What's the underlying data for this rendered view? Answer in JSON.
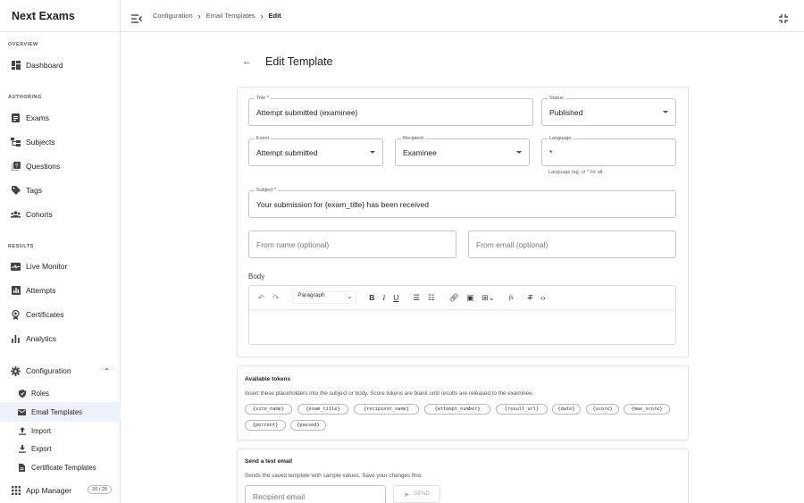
{
  "app": {
    "title": "Next Exams"
  },
  "sidebar": {
    "sections": {
      "overview": "OVERVIEW",
      "authoring": "AUTHORING",
      "results": "RESULTS"
    },
    "items": [
      {
        "label": "Dashboard",
        "icon": "dashboard-icon"
      },
      {
        "label": "Exams",
        "icon": "exams-icon"
      },
      {
        "label": "Subjects",
        "icon": "subjects-icon"
      },
      {
        "label": "Questions",
        "icon": "questions-icon"
      },
      {
        "label": "Tags",
        "icon": "tag-icon"
      },
      {
        "label": "Cohorts",
        "icon": "cohorts-icon"
      },
      {
        "label": "Live Monitor",
        "icon": "monitor-icon"
      },
      {
        "label": "Attempts",
        "icon": "attempts-icon"
      },
      {
        "label": "Certificates",
        "icon": "certificate-icon"
      },
      {
        "label": "Analytics",
        "icon": "analytics-icon"
      },
      {
        "label": "Configuration",
        "icon": "gear-icon"
      }
    ],
    "config_sub": [
      {
        "label": "Roles",
        "icon": "shield-icon"
      },
      {
        "label": "Email Templates",
        "icon": "mail-icon"
      },
      {
        "label": "Import",
        "icon": "upload-icon"
      },
      {
        "label": "Export",
        "icon": "download-icon"
      },
      {
        "label": "Certificate Templates",
        "icon": "document-icon"
      }
    ],
    "app_manager": {
      "label": "App Manager",
      "badge": "20 / 20"
    }
  },
  "breadcrumb": {
    "items": [
      "Configuration",
      "Email Templates",
      "Edit"
    ]
  },
  "page": {
    "title": "Edit Template"
  },
  "form": {
    "title": {
      "label": "Title *",
      "value": "Attempt submitted (examinee)"
    },
    "status": {
      "label": "Status",
      "value": "Published"
    },
    "event": {
      "label": "Event",
      "value": "Attempt submitted"
    },
    "recipient": {
      "label": "Recipient",
      "value": "Examinee"
    },
    "language": {
      "label": "Language",
      "value": "*",
      "helper": "Language tag, or * for all"
    },
    "subject": {
      "label": "Subject *",
      "value": "Your submission for {exam_title} has been received"
    },
    "from_name": {
      "placeholder": "From name (optional)"
    },
    "from_email": {
      "placeholder": "From email (optional)"
    },
    "body_label": "Body",
    "paragraph": "Paragraph"
  },
  "tokens": {
    "title": "Available tokens",
    "description": "Insert these placeholders into the subject or body. Score tokens are blank until results are released to the examinee.",
    "list": [
      "{site_name}",
      "{exam_title}",
      "{recipient_name}",
      "{attempt_number}",
      "{result_url}",
      "{date}",
      "{score}",
      "{max_score}",
      "{percent}",
      "{passed}"
    ]
  },
  "test_email": {
    "title": "Send a test email",
    "description": "Sends the saved template with sample values. Save your changes first.",
    "placeholder": "Recipient email",
    "send_label": "SEND"
  }
}
